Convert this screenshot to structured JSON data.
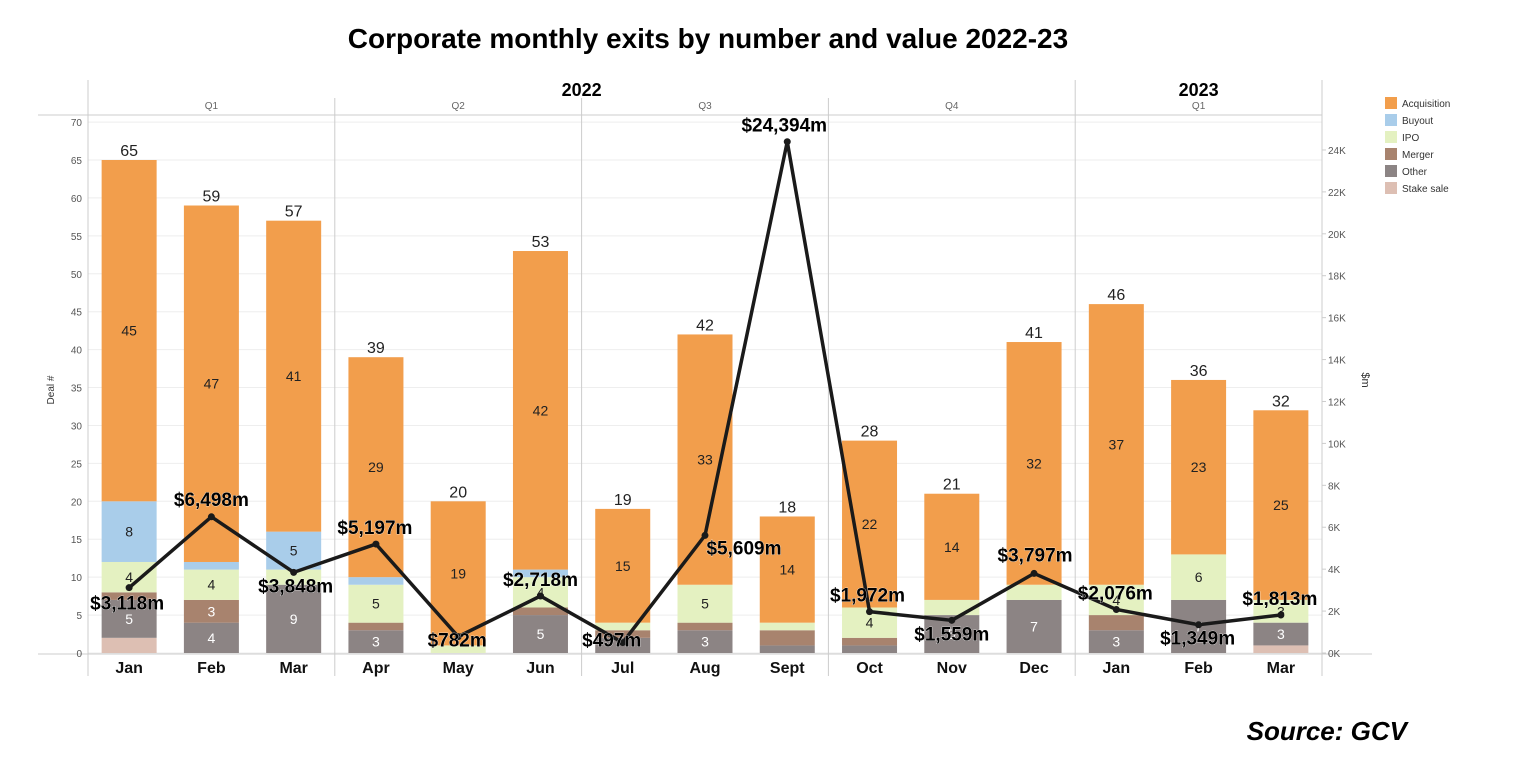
{
  "chart_data": {
    "type": "bar",
    "title": "Corporate monthly exits by number and value 2022-23",
    "source": "Source: GCV",
    "ylabel": "Deal #",
    "y2label": "$m",
    "ylim": [
      0,
      70
    ],
    "yticks": [
      0,
      5,
      10,
      15,
      20,
      25,
      30,
      35,
      40,
      45,
      50,
      55,
      60,
      65,
      70
    ],
    "y2lim": [
      0,
      25000
    ],
    "y2ticks": [
      "0K",
      "2K",
      "4K",
      "6K",
      "8K",
      "10K",
      "12K",
      "14K",
      "16K",
      "18K",
      "20K",
      "22K",
      "24K"
    ],
    "y2tick_values": [
      0,
      2000,
      4000,
      6000,
      8000,
      10000,
      12000,
      14000,
      16000,
      18000,
      20000,
      22000,
      24000
    ],
    "grid": true,
    "legend_placement": "right",
    "years": [
      {
        "label": "2022",
        "quarters": [
          "Q1",
          "Q2",
          "Q3",
          "Q4"
        ]
      },
      {
        "label": "2023",
        "quarters": [
          "Q1"
        ]
      }
    ],
    "categories": [
      "Jan",
      "Feb",
      "Mar",
      "Apr",
      "May",
      "Jun",
      "Jul",
      "Aug",
      "Sept",
      "Oct",
      "Nov",
      "Dec",
      "Jan",
      "Feb",
      "Mar"
    ],
    "totals": [
      65,
      59,
      57,
      39,
      20,
      53,
      19,
      42,
      18,
      28,
      21,
      41,
      46,
      36,
      32
    ],
    "series": [
      {
        "name": "Stake sale",
        "color": "#DDBFB3",
        "values": [
          2,
          0,
          0,
          0,
          0,
          0,
          0,
          0,
          0,
          0,
          0,
          0,
          0,
          0,
          1
        ]
      },
      {
        "name": "Other",
        "color": "#8C8484",
        "values": [
          5,
          4,
          9,
          3,
          0,
          5,
          2,
          3,
          1,
          1,
          5,
          7,
          3,
          7,
          3
        ]
      },
      {
        "name": "Merger",
        "color": "#A8836E",
        "values": [
          1,
          3,
          0,
          1,
          0,
          1,
          1,
          1,
          2,
          1,
          0,
          0,
          2,
          0,
          0
        ]
      },
      {
        "name": "IPO",
        "color": "#E4F1C1",
        "values": [
          4,
          4,
          2,
          5,
          1,
          4,
          1,
          5,
          1,
          4,
          2,
          2,
          4,
          6,
          3
        ]
      },
      {
        "name": "Buyout",
        "color": "#A9CDEA",
        "values": [
          8,
          1,
          5,
          1,
          0,
          1,
          0,
          0,
          0,
          0,
          0,
          0,
          0,
          0,
          0
        ]
      },
      {
        "name": "Acquisition",
        "color": "#F29E4C",
        "values": [
          45,
          47,
          41,
          29,
          19,
          42,
          15,
          33,
          14,
          22,
          14,
          32,
          37,
          23,
          25
        ]
      }
    ],
    "legend_order": [
      "Acquisition",
      "Buyout",
      "IPO",
      "Merger",
      "Other",
      "Stake sale"
    ],
    "value_line": {
      "color": "#1a1a1a",
      "values": [
        3118,
        6498,
        3848,
        5197,
        782,
        2718,
        497,
        5609,
        24394,
        1972,
        1559,
        3797,
        2076,
        1349,
        1813
      ],
      "labels": [
        "$3,118m",
        "$6,498m",
        "$3,848m",
        "$5,197m",
        "$782m",
        "$2,718m",
        "$497m",
        "$5,609m",
        "$24,394m",
        "$1,972m",
        "$1,559m",
        "$3,797m",
        "$2,076m",
        "$1,349m",
        "$1,813m"
      ]
    }
  }
}
